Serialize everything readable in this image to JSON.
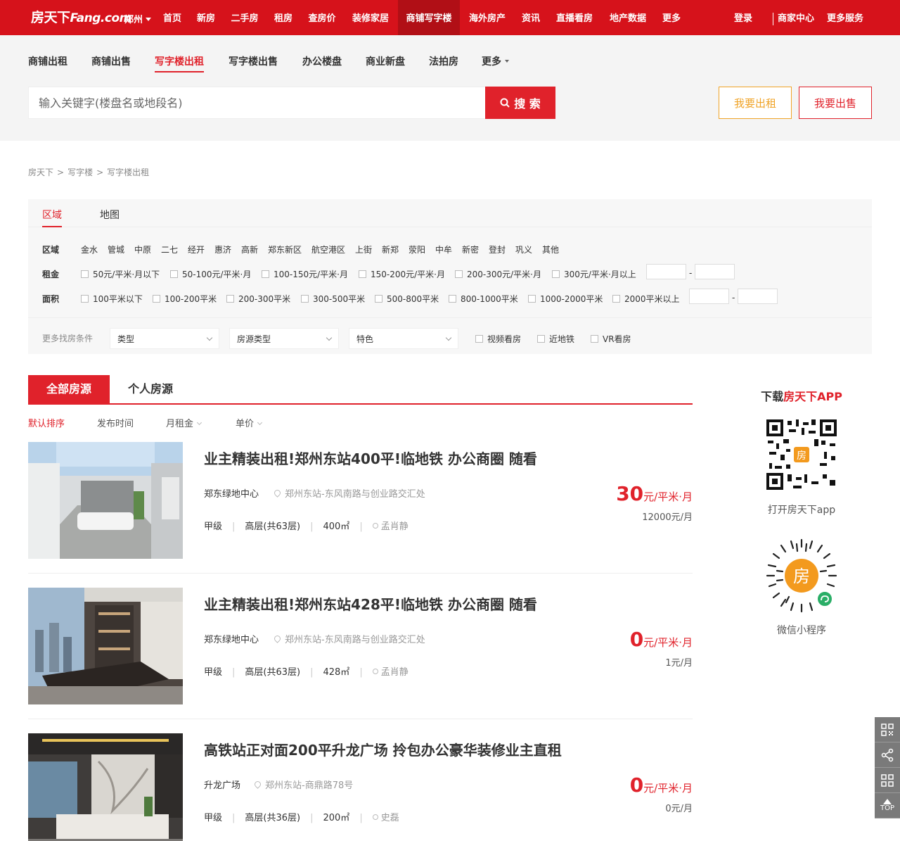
{
  "topbar": {
    "logo_cn": "房天下",
    "logo_domain": "Fang.com",
    "city": "郑州",
    "nav": [
      "首页",
      "新房",
      "二手房",
      "租房",
      "查房价",
      "装修家居",
      "商铺写字楼",
      "海外房产",
      "资讯",
      "直播看房",
      "地产数据",
      "更多"
    ],
    "active_nav": "商铺写字楼",
    "login": "登录",
    "merchant": "商家中心",
    "more_services": "更多服务"
  },
  "subnav": {
    "items": [
      "商铺出租",
      "商铺出售",
      "写字楼出租",
      "写字楼出售",
      "办公楼盘",
      "商业新盘",
      "法拍房",
      "更多"
    ],
    "active": "写字楼出租"
  },
  "search": {
    "placeholder": "输入关键字(楼盘名或地段名)",
    "button": "搜 索",
    "rent_button": "我要出租",
    "sell_button": "我要出售"
  },
  "breadcrumb": [
    "房天下",
    "写字楼",
    "写字楼出租"
  ],
  "filter": {
    "tabs": [
      "区域",
      "地图"
    ],
    "area_label": "区域",
    "areas": [
      "金水",
      "管城",
      "中原",
      "二七",
      "经开",
      "惠济",
      "高新",
      "郑东新区",
      "航空港区",
      "上街",
      "新郑",
      "荥阳",
      "中牟",
      "新密",
      "登封",
      "巩义",
      "其他"
    ],
    "rent_label": "租金",
    "rents": [
      "50元/平米·月以下",
      "50-100元/平米·月",
      "100-150元/平米·月",
      "150-200元/平米·月",
      "200-300元/平米·月",
      "300元/平米·月以上"
    ],
    "size_label": "面积",
    "sizes": [
      "100平米以下",
      "100-200平米",
      "200-300平米",
      "300-500平米",
      "500-800平米",
      "800-1000平米",
      "1000-2000平米",
      "2000平米以上"
    ],
    "range_dash": "-",
    "more_label": "更多找房条件",
    "selects": [
      "类型",
      "房源类型",
      "特色"
    ],
    "checks": [
      "视频看房",
      "近地铁",
      "VR看房"
    ]
  },
  "list": {
    "tabs": [
      "全部房源",
      "个人房源"
    ],
    "sorts": [
      "默认排序",
      "发布时间",
      "月租金",
      "单价"
    ]
  },
  "listings": [
    {
      "title": "业主精装出租!郑州东站400平!临地铁 办公商圈 随看",
      "building": "郑东绿地中心",
      "address": "郑州东站-东风南路与创业路交汇处",
      "grade": "甲级",
      "floor": "高层(共63层)",
      "area": "400㎡",
      "agent": "孟肖静",
      "price": "30",
      "price_unit": "元/平米·月",
      "total": "12000元/月"
    },
    {
      "title": "业主精装出租!郑州东站428平!临地铁 办公商圈 随看",
      "building": "郑东绿地中心",
      "address": "郑州东站-东风南路与创业路交汇处",
      "grade": "甲级",
      "floor": "高层(共63层)",
      "area": "428㎡",
      "agent": "孟肖静",
      "price": "0",
      "price_unit": "元/平米·月",
      "total": "1元/月"
    },
    {
      "title": "高铁站正对面200平升龙广场 拎包办公豪华装修业主直租",
      "building": "升龙广场",
      "address": "郑州东站-商鼎路78号",
      "grade": "甲级",
      "floor": "高层(共36层)",
      "area": "200㎡",
      "agent": "史磊",
      "price": "0",
      "price_unit": "元/平米·月",
      "total": "0元/月"
    }
  ],
  "sidebar": {
    "download_prefix": "下载",
    "download_brand": "房天下APP",
    "qr_label": "打开房天下app",
    "mini_label": "微信小程序",
    "qr_badge": "房",
    "mini_badge": "房"
  },
  "tools": {
    "top_label": "TOP"
  },
  "colors": {
    "brand_red": "#d6121b",
    "accent_red": "#e0222b",
    "orange": "#f0a326"
  }
}
